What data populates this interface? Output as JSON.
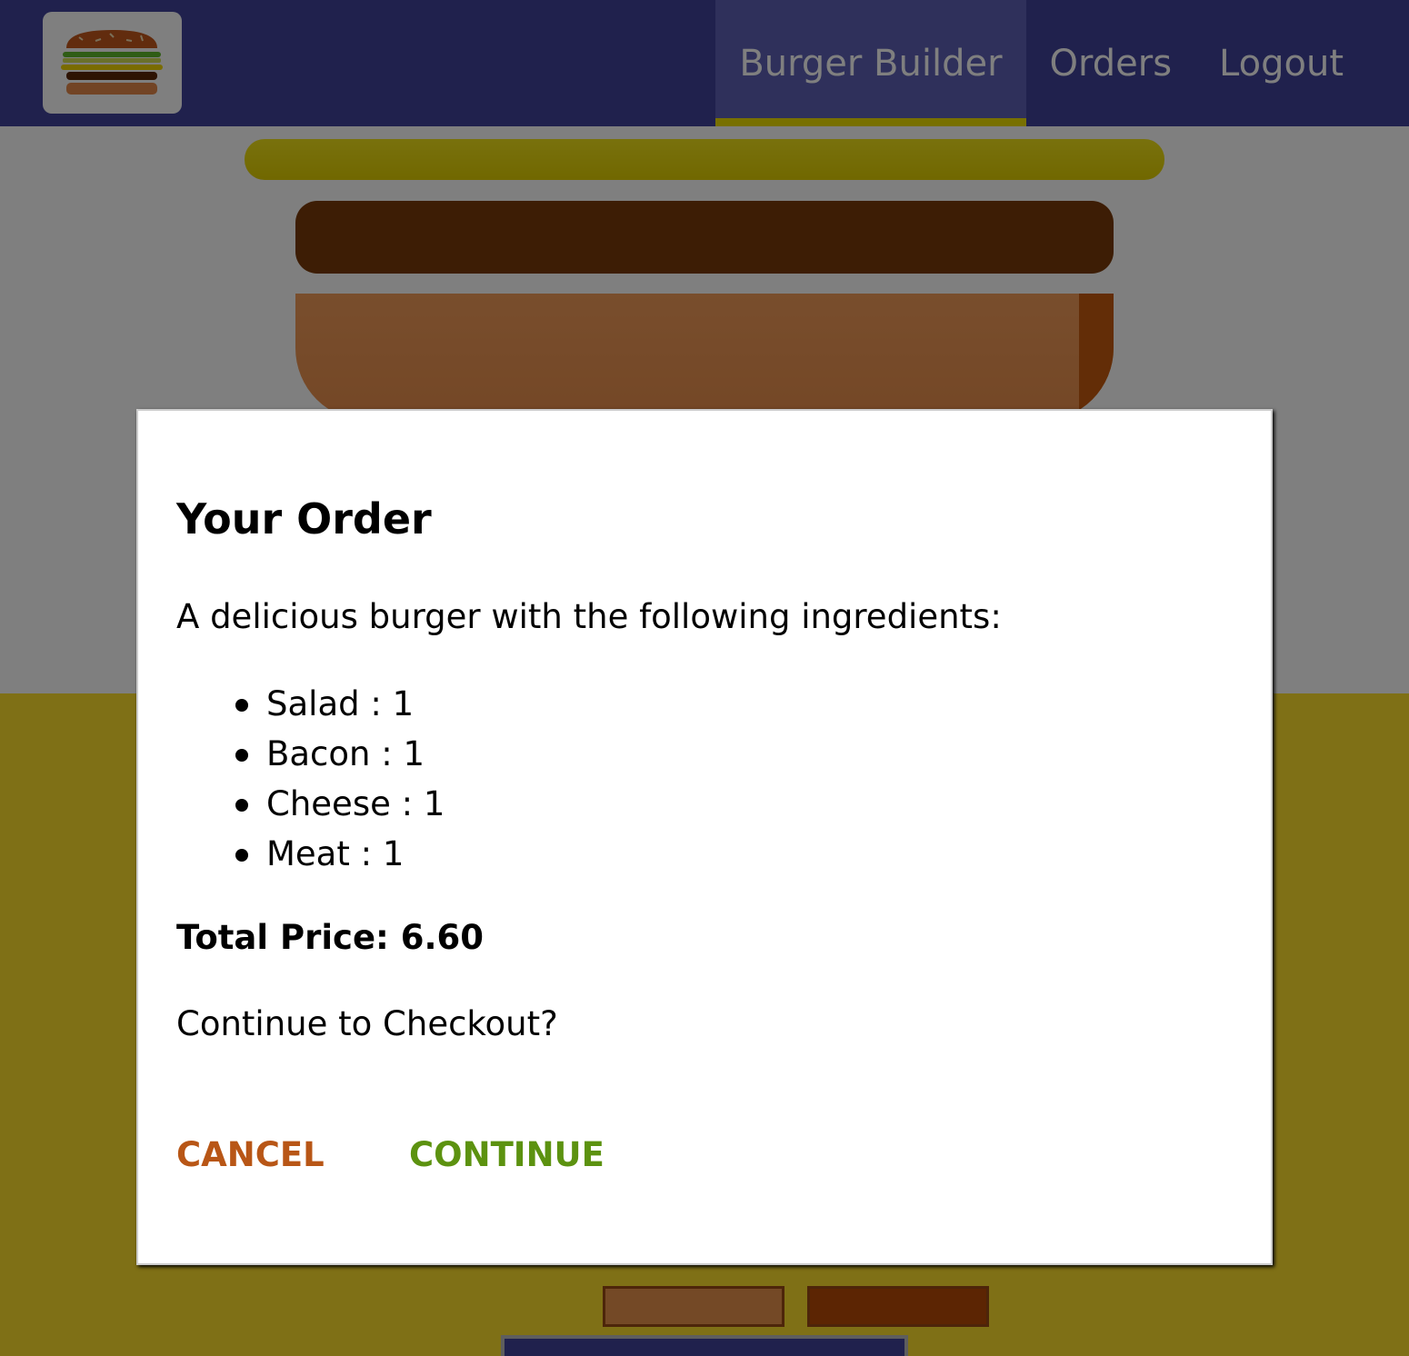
{
  "toolbar": {
    "logo_icon": "burger-logo-icon",
    "nav": [
      {
        "label": "Burger Builder",
        "active": true
      },
      {
        "label": "Orders",
        "active": false
      },
      {
        "label": "Logout",
        "active": false
      }
    ]
  },
  "modal": {
    "title": "Your Order",
    "description": "A delicious burger with the following ingredients:",
    "ingredients": [
      {
        "label": "Salad : 1"
      },
      {
        "label": "Bacon : 1"
      },
      {
        "label": "Cheese : 1"
      },
      {
        "label": "Meat : 1"
      }
    ],
    "total_price": "Total Price: 6.60",
    "question": "Continue to Checkout?",
    "cancel_label": "CANCEL",
    "continue_label": "CONTINUE"
  },
  "colors": {
    "toolbar": "#40429a",
    "active_underline": "#f0e000",
    "cancel": "#b85616",
    "continue": "#5c9210",
    "controls_bg": "#ffe02d"
  }
}
